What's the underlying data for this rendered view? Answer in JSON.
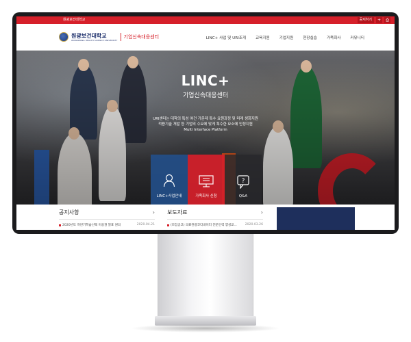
{
  "topbar": {
    "univ_link": "원광보건대학교",
    "btn1": "공지하기",
    "btn_plus": "+",
    "btn_print": "⎙",
    "bg_color": "#d6202a"
  },
  "header": {
    "logo_ko": "원광보건대학교",
    "logo_en": "WONKWANG HEALTH SCIENCE UNIVERSITY",
    "logo_sub": "기업신속대응센터",
    "nav": [
      "LINC+ 사업 및 URI조개",
      "교육지원",
      "기업지원",
      "현장실습",
      "가족회사",
      "커뮤니티"
    ]
  },
  "hero": {
    "title": "LINC+",
    "subtitle": "기업신속대응센터",
    "desc_line1": "URI센터는 대학의 특성 여건 가운데 특수 요원과정 및 미래 생화지원",
    "desc_line2": "적용기술 개발 등 기업의 수요에 맞게 특수한 요소에 인정지원",
    "desc_line3": "Multi Interface Platform",
    "quick_links": [
      {
        "label": "LINC+사업안내",
        "icon": "person-icon"
      },
      {
        "label": "가족회사 신청",
        "icon": "monitor-icon"
      },
      {
        "label": "Q&A",
        "icon": "question-bubble-icon"
      }
    ]
  },
  "panels": {
    "notice": {
      "title": "공지사항",
      "arrow": "›",
      "item": "2020년도 하반기학습선택 이용권 발표 원의",
      "date": "2020.04.21"
    },
    "press": {
      "title": "보도자료",
      "arrow": "›",
      "item": "(모집공고) 의료관광코디네이터 전문인력 양성교...",
      "date": "2020.03.26"
    }
  }
}
